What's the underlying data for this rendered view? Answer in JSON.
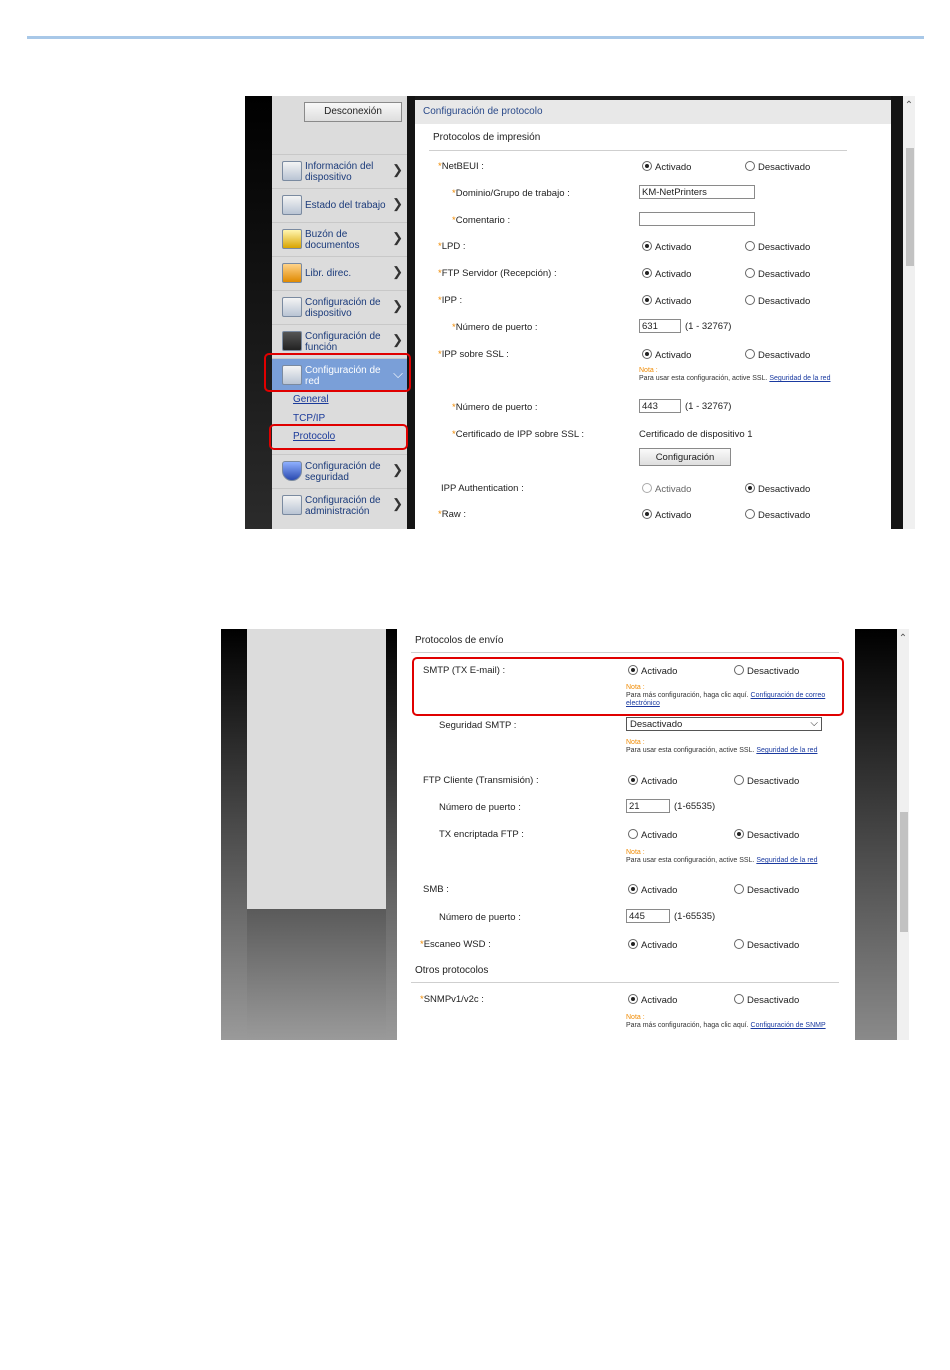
{
  "screen1": {
    "logout": "Desconexión",
    "nav": [
      {
        "label": "Información del dispositivo",
        "icon": "device-info-icon"
      },
      {
        "label": "Estado del trabajo",
        "icon": "job-status-icon"
      },
      {
        "label": "Buzón de documentos",
        "icon": "document-box-icon"
      },
      {
        "label": "Libr. direc.",
        "icon": "address-book-icon"
      },
      {
        "label": "Configuración de dispositivo",
        "icon": "device-settings-icon"
      },
      {
        "label": "Configuración de función",
        "icon": "function-settings-icon"
      },
      {
        "label": "Configuración de red",
        "icon": "network-settings-icon"
      }
    ],
    "nav_sub": [
      "General",
      "TCP/IP",
      "Protocolo"
    ],
    "nav_lower": [
      {
        "label": "Configuración de seguridad",
        "icon": "security-shield-icon"
      },
      {
        "label": "Configuración de administración",
        "icon": "admin-settings-icon"
      }
    ],
    "panel_title": "Configuración de protocolo",
    "section": "Protocolos de impresión",
    "radio_on": "Activado",
    "radio_off": "Desactivado",
    "rows": {
      "netbeui": "NetBEUI :",
      "domain": "Dominio/Grupo de trabajo :",
      "domain_value": "KM-NetPrinters",
      "comment": "Comentario :",
      "comment_value": "",
      "lpd": "LPD :",
      "ftp_server": "FTP Servidor (Recepción) :",
      "ipp": "IPP :",
      "port": "Número de puerto :",
      "ipp_port": "631",
      "ipp_range": "(1 - 32767)",
      "ipp_ssl": "IPP sobre SSL :",
      "note_label": "Nota :",
      "ssl_note": "Para usar esta configuración, active SSL.",
      "ssl_link": "Seguridad de la red",
      "ssl_port": "443",
      "ssl_range": "(1 - 32767)",
      "cert": "Certificado de IPP sobre SSL :",
      "cert_value": "Certificado de dispositivo 1",
      "config_button": "Configuración",
      "ipp_auth": "IPP Authentication :",
      "raw": "Raw :"
    }
  },
  "screen2": {
    "section_send": "Protocolos de envío",
    "radio_on": "Activado",
    "radio_off": "Desactivado",
    "note_label": "Nota :",
    "smtp": "SMTP (TX E-mail) :",
    "smtp_note": "Para más configuración, haga clic aquí.",
    "smtp_link": "Configuración de correo electrónico",
    "smtp_sec": "Seguridad SMTP :",
    "smtp_sec_value": "Desactivado",
    "ssl_note": "Para usar esta configuración, active SSL.",
    "ssl_link": "Seguridad de la red",
    "ftp_client": "FTP Cliente (Transmisión) :",
    "port": "Número de puerto :",
    "ftp_port": "21",
    "ftp_range": "(1-65535)",
    "ftp_enc": "TX encriptada FTP :",
    "smb": "SMB :",
    "smb_port": "445",
    "smb_range": "(1-65535)",
    "wsd": "Escaneo WSD :",
    "section_other": "Otros protocolos",
    "snmp": "SNMPv1/v2c :",
    "snmp_note": "Para más configuración, haga clic aquí.",
    "snmp_link": "Configuración de SNMP"
  }
}
